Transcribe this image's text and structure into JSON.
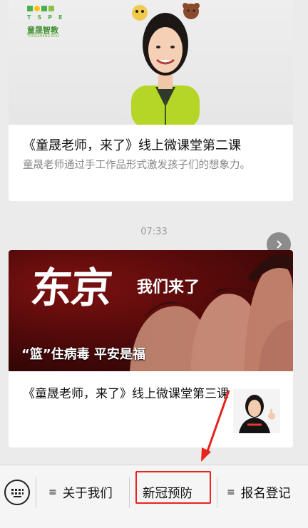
{
  "card1": {
    "logo_letters": "TSPE",
    "logo_name": "童晟智教",
    "logo_sub": "TONGSHENG EDU",
    "title": "《童晟老师，来了》线上微课堂第二课",
    "description": "童晟老师通过手工作品形式激发孩子们的想象力。"
  },
  "timestamp": "07:33",
  "card2": {
    "poster_title": "东京",
    "poster_subtitle": "我们来了",
    "poster_caption": "“篮”住病毒 平安是福",
    "title": "《童晟老师，来了》线上微课堂第三课"
  },
  "menu": {
    "items": [
      {
        "label": "关于我们",
        "has_submenu": true
      },
      {
        "label": "新冠预防",
        "has_submenu": false
      },
      {
        "label": "报名登记",
        "has_submenu": true
      }
    ]
  },
  "colors": {
    "highlight": "#e8221d",
    "background": "#ebebeb",
    "brand_green": "#4caf50"
  },
  "icons": {
    "keyboard": "keyboard-icon",
    "share": "chevron-right-icon",
    "submenu": "hamburger-icon"
  }
}
